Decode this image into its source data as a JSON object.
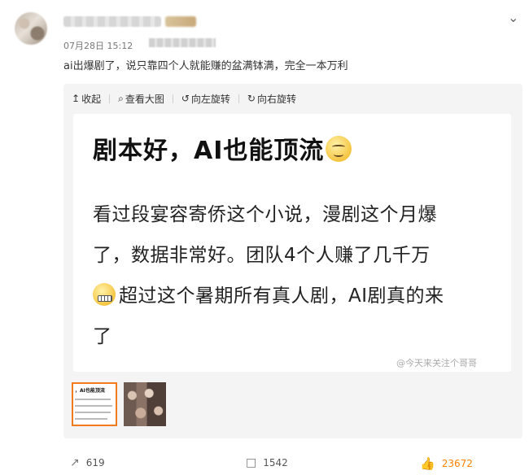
{
  "post": {
    "date": "07月28日 15:12",
    "text": "ai出爆剧了，说只靠四个人就能赚的盆满钵满，完全一本万利"
  },
  "toolbar": {
    "collapse": "收起",
    "view_large": "查看大图",
    "rotate_left": "向左旋转",
    "rotate_right": "向右旋转"
  },
  "image": {
    "title": "剧本好，AI也能顶流",
    "lines": [
      "看过段宴容寄侨这个小说，漫剧这个月爆",
      "了，数据非常好。团队4个人赚了几千万",
      "超过这个暑期所有真人剧，AI剧真的来",
      "了"
    ],
    "watermark": "@今天来关注个哥哥"
  },
  "thumbnail": {
    "title": "，AI也能顶流"
  },
  "actions": {
    "repost": "619",
    "comment": "1542",
    "like": "23672"
  },
  "icons": {
    "more": "chevron-down-icon",
    "repost": "share-icon",
    "comment": "comment-icon",
    "like": "thumbs-up-icon"
  },
  "colors": {
    "accent": "#ff8200",
    "thumb_border": "#f37b1d"
  }
}
